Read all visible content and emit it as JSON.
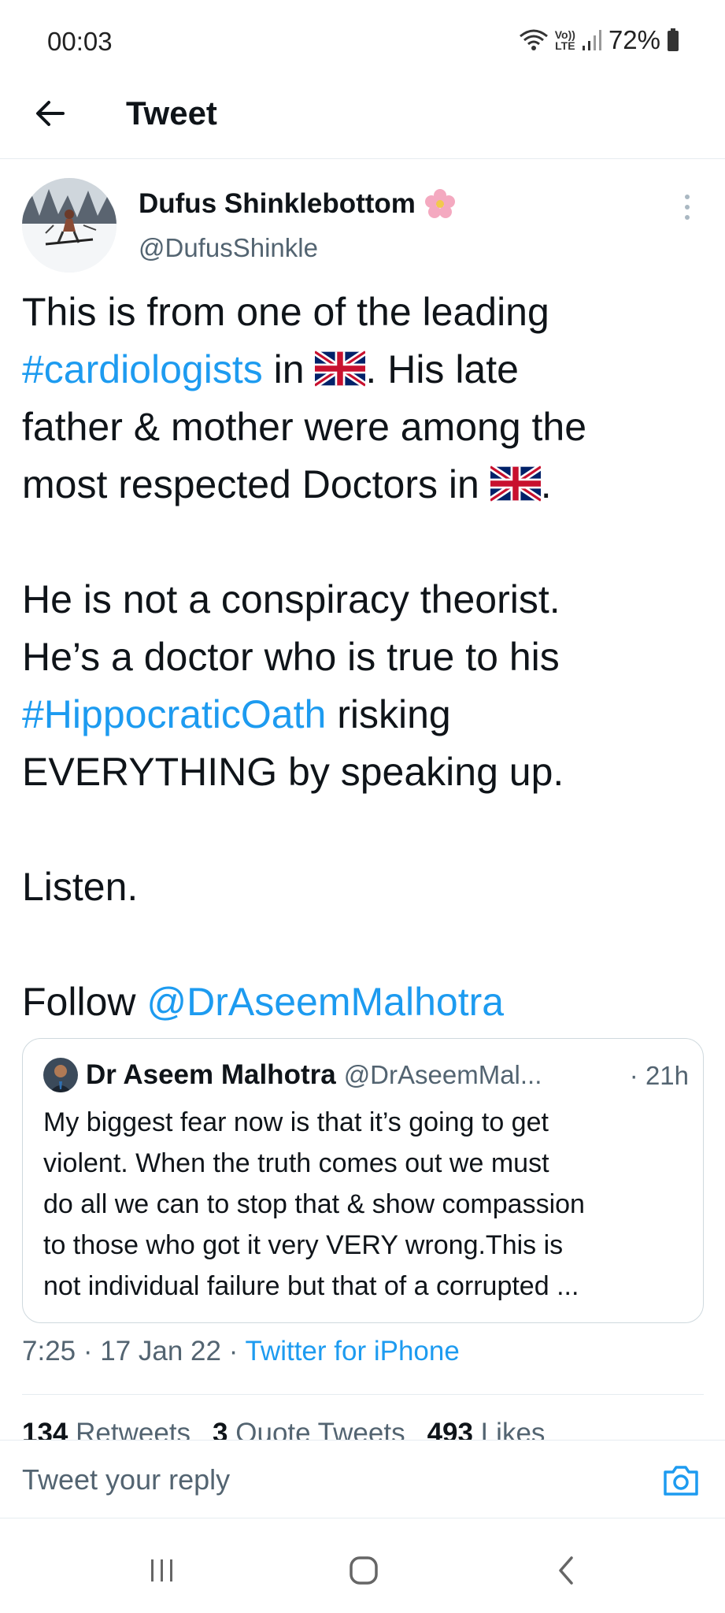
{
  "status_bar": {
    "time": "00:03",
    "lte_top": "Vo))",
    "lte_bottom": "LTE",
    "battery": "72%"
  },
  "header": {
    "title": "Tweet"
  },
  "author": {
    "name": "Dufus Shinklebottom",
    "handle": "@DufusShinkle"
  },
  "tweet": {
    "p1_a": "This is from one of the leading",
    "p1_hashtag": "#cardiologists",
    "p1_b": " in ",
    "p1_c": ". His late",
    "p1_d": "father & mother were among the",
    "p1_e": "most respected Doctors in ",
    "p1_f": ".",
    "p2_a": "He is not a conspiracy theorist.",
    "p2_b": "He’s a doctor who is true to his",
    "p2_hashtag": "#HippocraticOath",
    "p2_c": " risking",
    "p2_d": "EVERYTHING by speaking up.",
    "p3": "Listen.",
    "p4_a": "Follow ",
    "p4_mention": "@DrAseemMalhotra"
  },
  "quote": {
    "name": "Dr Aseem Malhotra",
    "handle": "@DrAseemMal...",
    "time": "· 21h",
    "lines": [
      "My biggest fear now is that it’s going to get",
      "violent. When the truth comes out we must",
      "do all we can to stop that & show compassion",
      "to those who got it very VERY wrong.This is",
      "not individual failure but that of a corrupted ..."
    ]
  },
  "meta": {
    "time": "7:25",
    "sep1": " · ",
    "date": "17 Jan 22",
    "sep2": " · ",
    "source": "Twitter for iPhone"
  },
  "stats": {
    "retweets_count": "134",
    "retweets_label": "Retweets",
    "quotes_count": "3",
    "quotes_label": "Quote Tweets",
    "likes_count": "493",
    "likes_label": "Likes"
  },
  "reply": {
    "placeholder": "Tweet your reply"
  },
  "colors": {
    "link": "#1d9bf0",
    "secondary_text": "#536471",
    "primary_text": "#0f1419",
    "divider": "#e6ecf0"
  },
  "icons": [
    "back-arrow-icon",
    "flower-icon",
    "more-vertical-icon",
    "uk-flag-icon",
    "camera-icon",
    "recents-icon",
    "home-icon",
    "back-nav-icon"
  ]
}
